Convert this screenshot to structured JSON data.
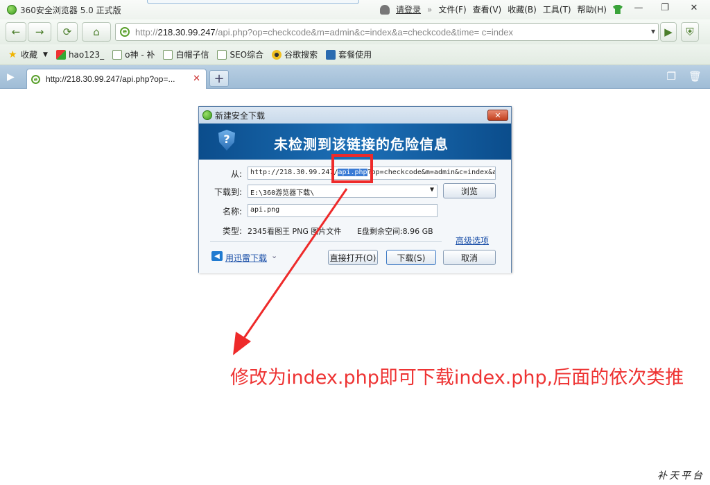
{
  "window": {
    "title": "360安全浏览器 5.0 正式版",
    "menu": {
      "login": "请登录",
      "file": "文件(F)",
      "view": "查看(V)",
      "favorites": "收藏(B)",
      "tools": "工具(T)",
      "help": "帮助(H)"
    },
    "controls": {
      "minimize": "—",
      "maximize": "❐",
      "close": "✕"
    }
  },
  "navbar": {
    "back": "←",
    "forward": "→",
    "refresh": "⟳",
    "home": "⌂",
    "url_prefix": "http://",
    "url_host": "218.30.99.247",
    "url_rest": "/api.php?op=checkcode&m=admin&c=index&a=checkcode&time= c=index",
    "dropdown": "▾",
    "go": "▶"
  },
  "bookmarks": [
    {
      "label": "收藏",
      "icon": "star-icon"
    },
    {
      "label": "hao123_",
      "icon": "hao123-icon"
    },
    {
      "label": "o神 - 补",
      "icon": "page-icon"
    },
    {
      "label": "白帽子信",
      "icon": "page-icon"
    },
    {
      "label": "SEO综合",
      "icon": "page-icon"
    },
    {
      "label": "谷歌搜索",
      "icon": "gear-icon"
    },
    {
      "label": "套餐使用",
      "icon": "network-icon"
    }
  ],
  "tabs": {
    "active_title": "http://218.30.99.247/api.php?op=...",
    "close": "✕",
    "new_tab": "+"
  },
  "dialog": {
    "title": "新建安全下载",
    "close": "✕",
    "banner": "未检测到该链接的危险信息",
    "from_label": "从:",
    "from_url_before": "http://218.30.99.247/",
    "from_url_highlight": "api.php",
    "from_url_after": "?op=checkcode&m=admin&c=index&a",
    "download_to_label": "下载到:",
    "download_to_value": "E:\\360游览器下载\\",
    "browse_button": "浏览",
    "name_label": "名称:",
    "name_value": "api.png",
    "type_label": "类型:",
    "type_value": "2345看图王 PNG 图片文件",
    "disk_space": "E盘剩余空间:8.96 GB",
    "advanced_link": "高级选项",
    "thunder_link": "用迅雷下载",
    "open_button": "直接打开(O)",
    "download_button": "下载(S)",
    "cancel_button": "取消"
  },
  "annotation": {
    "text": "修改为index.php即可下载index.php,后面的依次类推",
    "color": "#ee3333"
  },
  "watermark": "补天平台"
}
